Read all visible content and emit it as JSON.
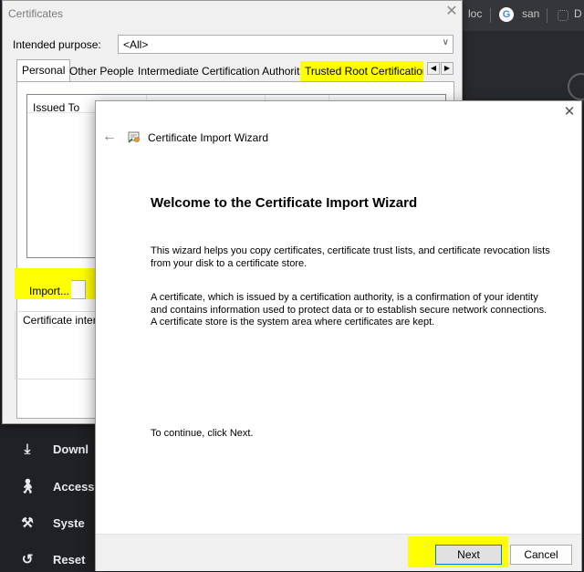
{
  "browser": {
    "tabs": [
      "loc",
      "san",
      "D"
    ],
    "menu": [
      "Downl",
      "Access",
      "Syste",
      "Reset"
    ]
  },
  "certificates_dialog": {
    "title": "Certificates",
    "intended_purpose_label": "Intended purpose:",
    "intended_purpose_value": "<All>",
    "tabs": [
      "Personal",
      "Other People",
      "Intermediate Certification Authorities",
      "Trusted Root Certification"
    ],
    "list_header": "Issued To",
    "import_label": "Import...",
    "purpose_label": "Certificate intended purposes",
    "highlight_color": "#ffff00"
  },
  "wizard": {
    "title": "Certificate Import Wizard",
    "heading": "Welcome to the Certificate Import Wizard",
    "paragraph1": "This wizard helps you copy certificates, certificate trust lists, and certificate revocation lists from your disk to a certificate store.",
    "paragraph2": "A certificate, which is issued by a certification authority, is a confirmation of your identity and contains information used to protect data or to establish secure network connections. A certificate store is the system area where certificates are kept.",
    "continue_text": "To continue, click Next.",
    "next_label": "Next",
    "cancel_label": "Cancel"
  }
}
